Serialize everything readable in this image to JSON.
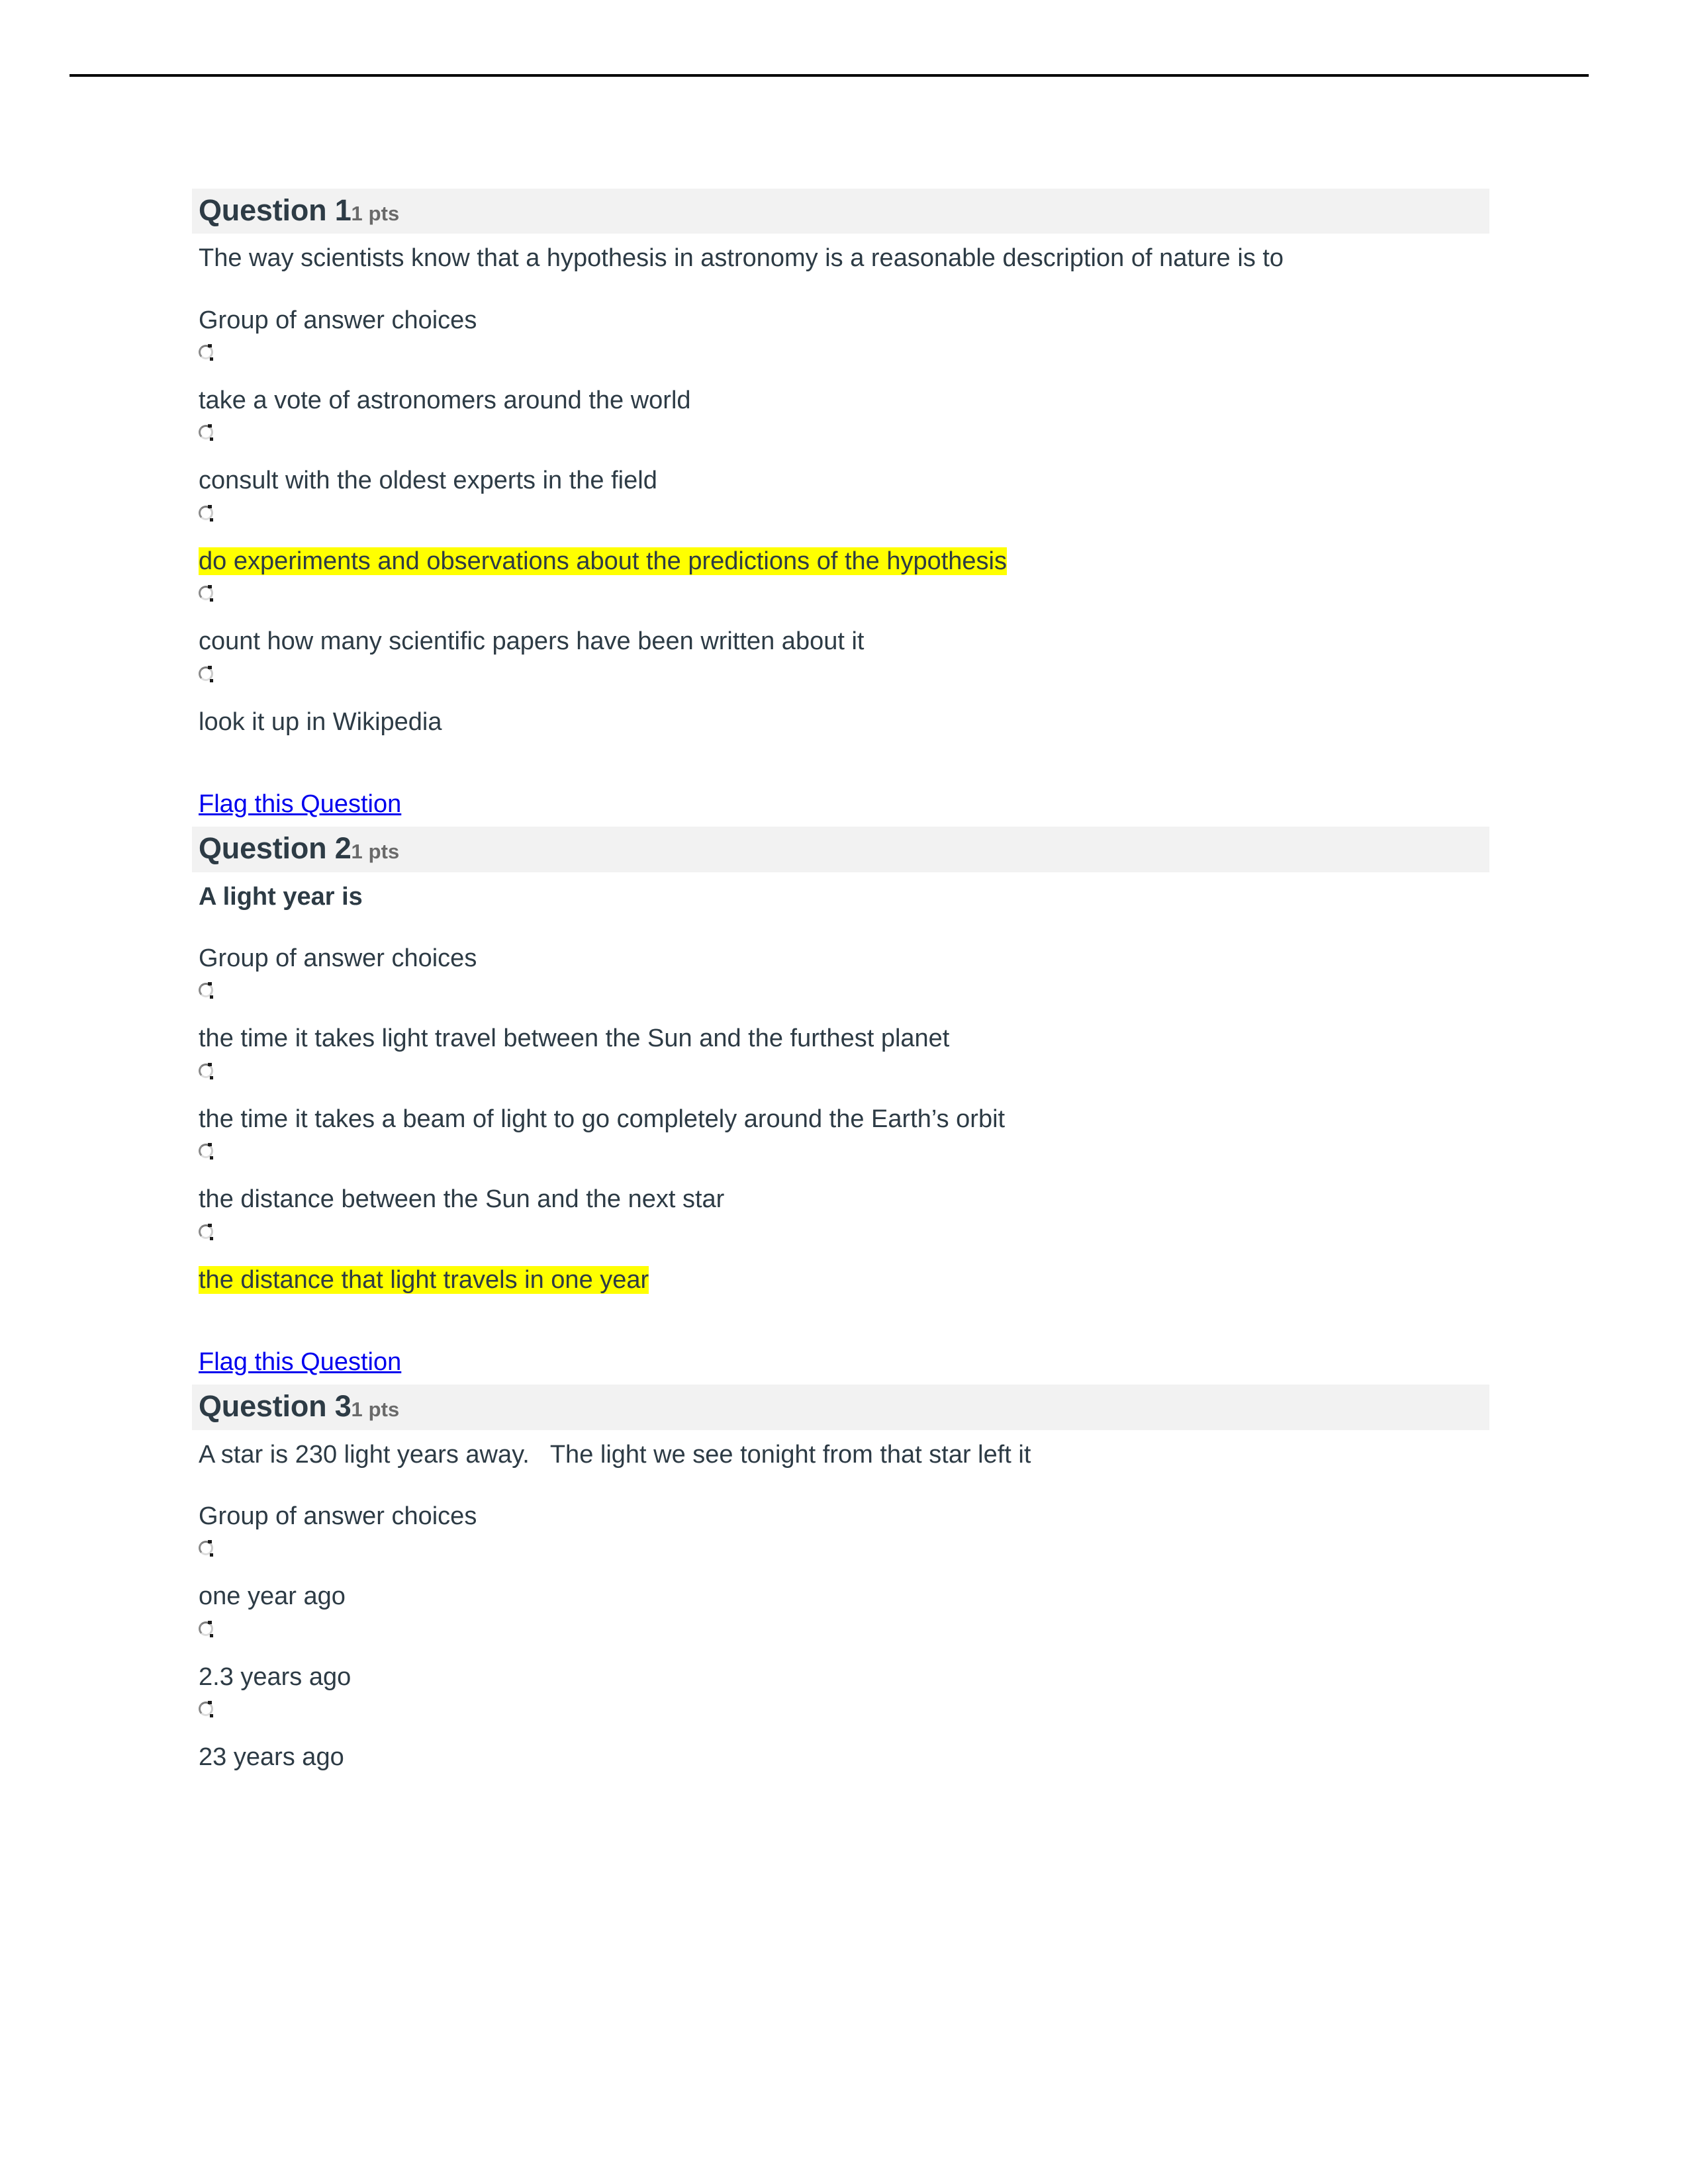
{
  "document": {
    "type": "quiz-printout",
    "colors": {
      "text": "#2D3B45",
      "header_background": "#F2F2F2",
      "points_text": "#6A6A6A",
      "highlight": "#FFFF00",
      "link": "#0000EE",
      "rule": "#000000"
    }
  },
  "choices_label": "Group of answer choices",
  "flag_link_label": "Flag this Question",
  "questions": [
    {
      "title": "Question 1",
      "points": "1 pts",
      "stem": "The way scientists know that a hypothesis in astronomy is a reasonable description of nature is to",
      "stem_bold": false,
      "options": [
        {
          "text": "take a vote of astronomers around the world",
          "highlighted": false
        },
        {
          "text": "consult with the oldest experts in the field",
          "highlighted": false
        },
        {
          "text": "do experiments and observations about the predictions of the hypothesis",
          "highlighted": true
        },
        {
          "text": "count how many scientific papers have been written about it",
          "highlighted": false
        },
        {
          "text": "look it up in Wikipedia",
          "highlighted": false
        }
      ],
      "has_flag_link_after": true
    },
    {
      "title": "Question 2",
      "points": "1 pts",
      "stem": "A light year is",
      "stem_bold": true,
      "options": [
        {
          "text": "the time it takes light travel between the Sun and the furthest planet",
          "highlighted": false
        },
        {
          "text": "the time it takes a beam of light to go completely around the Earth’s orbit",
          "highlighted": false
        },
        {
          "text": "the distance between the Sun and the next star",
          "highlighted": false
        },
        {
          "text": "the distance that light travels in one year",
          "highlighted": true
        }
      ],
      "has_flag_link_after": true
    },
    {
      "title": "Question 3",
      "points": "1 pts",
      "stem": "A star is 230 light years away.   The light we see tonight from that star left it",
      "stem_bold": false,
      "options": [
        {
          "text": "one year ago",
          "highlighted": false
        },
        {
          "text": "2.3 years ago",
          "highlighted": false
        },
        {
          "text": "23 years ago",
          "highlighted": false
        }
      ],
      "has_flag_link_after": false
    }
  ]
}
